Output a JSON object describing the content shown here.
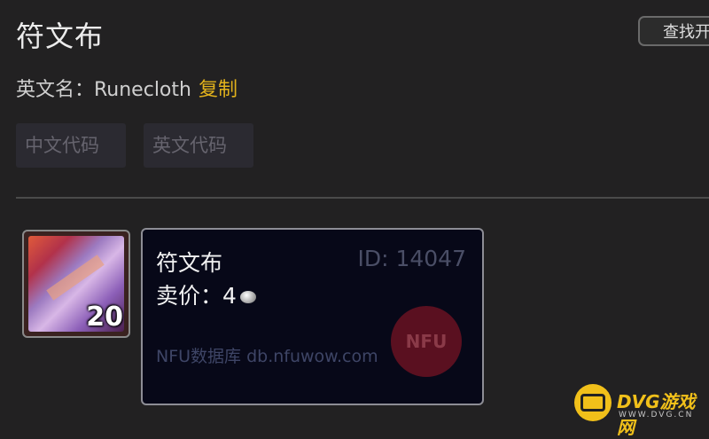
{
  "header": {
    "title": "符文布",
    "find_button": "查找开"
  },
  "english_name": {
    "label": "英文名：Runecloth",
    "copy": "复制"
  },
  "tags": {
    "chinese_code": "中文代码",
    "english_code": "英文代码"
  },
  "item_icon": {
    "stack_count": "20"
  },
  "tooltip": {
    "name": "符文布",
    "id": "ID: 14047",
    "price": "卖价：4",
    "logo": "NFU",
    "footer": "NFU数据库 db.nfuwow.com"
  },
  "watermark": {
    "brand": "DVG游戏网",
    "url": "WWW.DVG.CN"
  }
}
